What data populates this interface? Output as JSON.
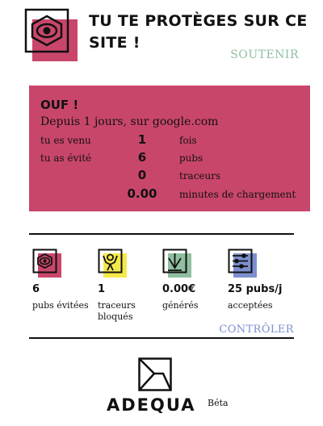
{
  "header": {
    "title": "TU TE PROTÈGES SUR CE SITE !",
    "support_link": "SOUTENIR",
    "logo_icon": "shield-eye-icon"
  },
  "summary": {
    "title": "OUF !",
    "subtitle": "Depuis 1 jours, sur google.com",
    "rows": [
      {
        "label": "tu es venu",
        "value": "1",
        "unit": "fois"
      },
      {
        "label": "tu as évité",
        "value": "6",
        "unit": "pubs"
      },
      {
        "label": "",
        "value": "0",
        "unit": "traceurs"
      },
      {
        "label": "",
        "value": "0.00",
        "unit": "minutes de chargement"
      }
    ]
  },
  "stats": [
    {
      "icon": "ad-block-icon",
      "value": "6",
      "label": "pubs évitées"
    },
    {
      "icon": "tracker-icon",
      "value": "1",
      "label": "traceurs bloqués"
    },
    {
      "icon": "crown-money-icon",
      "value": "0.00€",
      "label": "générés"
    },
    {
      "icon": "sliders-icon",
      "value": "25 pubs/j",
      "label": "acceptées"
    }
  ],
  "controls": {
    "control_link": "CONTRÔLER"
  },
  "brand": {
    "name": "ADEQUA",
    "badge": "Béta"
  },
  "colors": {
    "accent_pink": "#c9466b",
    "accent_green": "#8fbf9f",
    "accent_yellow": "#f5e94a",
    "accent_blue": "#7d8fd0"
  }
}
